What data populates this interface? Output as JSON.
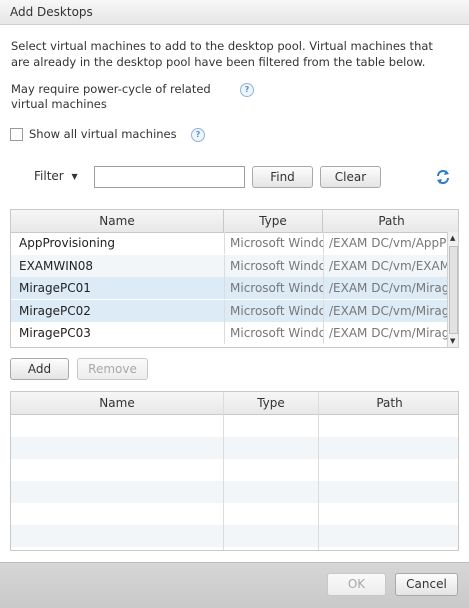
{
  "dialog": {
    "title": "Add Desktops"
  },
  "intro": {
    "line1": "Select virtual machines to add to the desktop pool. Virtual machines that",
    "line2": "are already in the desktop pool have been filtered from the table below.",
    "power_line1": "May require power-cycle of related",
    "power_line2": "virtual machines"
  },
  "show_all": {
    "label": "Show all virtual machines",
    "checked": false
  },
  "filter": {
    "label": "Filter",
    "value": "",
    "find_label": "Find",
    "clear_label": "Clear"
  },
  "vm_table": {
    "columns": [
      "Name",
      "Type",
      "Path"
    ],
    "rows": [
      {
        "name": "AppProvisioning",
        "type": "Microsoft Windo",
        "path": "/EXAM DC/vm/AppPr",
        "selected": false
      },
      {
        "name": "EXAMWIN08",
        "type": "Microsoft Windo",
        "path": "/EXAM DC/vm/EXAM",
        "selected": false
      },
      {
        "name": "MiragePC01",
        "type": "Microsoft Windo",
        "path": "/EXAM DC/vm/Mirag",
        "selected": true
      },
      {
        "name": "MiragePC02",
        "type": "Microsoft Windo",
        "path": "/EXAM DC/vm/Mirag",
        "selected": true
      },
      {
        "name": "MiragePC03",
        "type": "Microsoft Windo",
        "path": "/EXAM DC/vm/Mirag",
        "selected": false
      }
    ]
  },
  "actions": {
    "add_label": "Add",
    "remove_label": "Remove"
  },
  "selected_table": {
    "columns": [
      "Name",
      "Type",
      "Path"
    ]
  },
  "footer": {
    "ok_label": "OK",
    "cancel_label": "Cancel"
  }
}
